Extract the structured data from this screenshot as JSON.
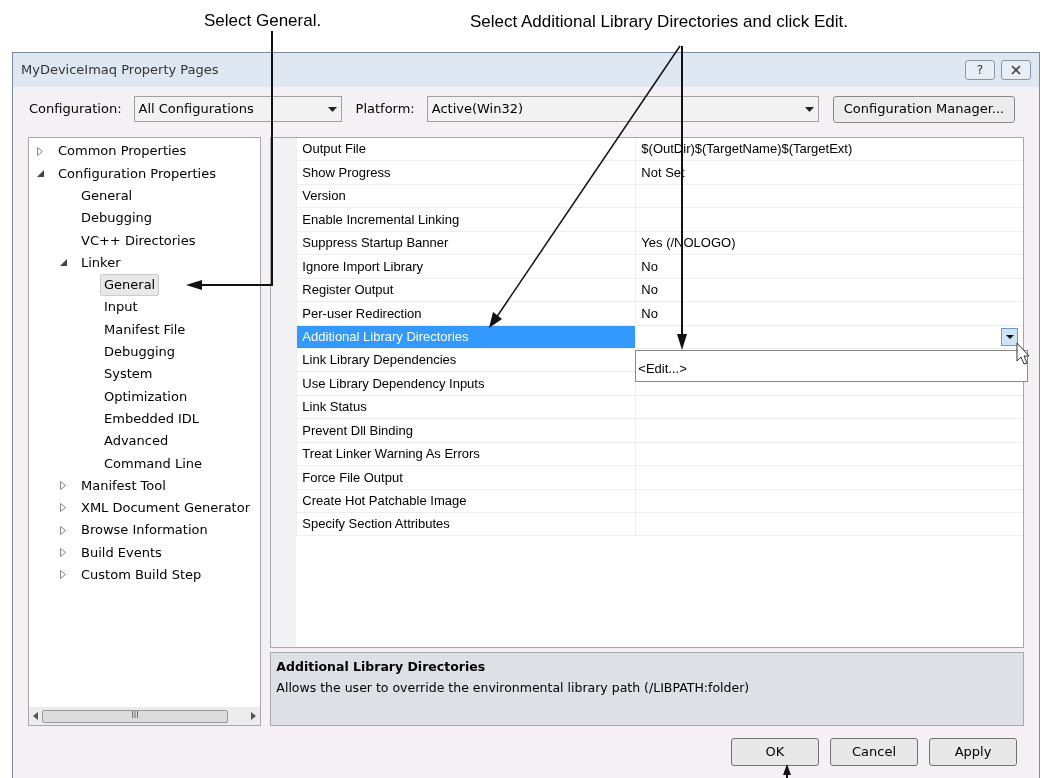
{
  "callouts": [
    "Select General.",
    "Select Additional Library Directories and click Edit."
  ],
  "window": {
    "title": "MyDeviceImaq Property Pages"
  },
  "configuration": {
    "label": "Configuration:",
    "value": "All Configurations"
  },
  "platform": {
    "label": "Platform:",
    "value": "Active(Win32)"
  },
  "configuration_manager_button": "Configuration Manager...",
  "tree": [
    {
      "label": "Common Properties",
      "expanded": false,
      "selected": false
    },
    {
      "label": "Configuration Properties",
      "expanded": true,
      "selected": false,
      "children": [
        {
          "label": "General",
          "selected": false
        },
        {
          "label": "Debugging",
          "selected": false
        },
        {
          "label": "VC++ Directories",
          "selected": false
        },
        {
          "label": "Linker",
          "expanded": true,
          "selected": false,
          "children": [
            {
              "label": "General",
              "selected": true
            },
            {
              "label": "Input",
              "selected": false
            },
            {
              "label": "Manifest File",
              "selected": false
            },
            {
              "label": "Debugging",
              "selected": false
            },
            {
              "label": "System",
              "selected": false
            },
            {
              "label": "Optimization",
              "selected": false
            },
            {
              "label": "Embedded IDL",
              "selected": false
            },
            {
              "label": "Advanced",
              "selected": false
            },
            {
              "label": "Command Line",
              "selected": false
            }
          ]
        },
        {
          "label": "Manifest Tool",
          "expanded": false,
          "selected": false
        },
        {
          "label": "XML Document Generator",
          "expanded": false,
          "selected": false
        },
        {
          "label": "Browse Information",
          "expanded": false,
          "selected": false
        },
        {
          "label": "Build Events",
          "expanded": false,
          "selected": false
        },
        {
          "label": "Custom Build Step",
          "expanded": false,
          "selected": false
        }
      ]
    }
  ],
  "properties": [
    {
      "name": "Output File",
      "value": "$(OutDir)$(TargetName)$(TargetExt)",
      "selected": false
    },
    {
      "name": "Show Progress",
      "value": "Not Set",
      "selected": false
    },
    {
      "name": "Version",
      "selected": false
    },
    {
      "name": "Enable Incremental Linking",
      "selected": false
    },
    {
      "name": "Suppress Startup Banner",
      "value": "Yes (/NOLOGO)",
      "selected": false
    },
    {
      "name": "Ignore Import Library",
      "value": "No",
      "selected": false
    },
    {
      "name": "Register Output",
      "value": "No",
      "selected": false
    },
    {
      "name": "Per-user Redirection",
      "value": "No",
      "selected": false
    },
    {
      "name": "Additional Library Directories",
      "selected": true
    },
    {
      "name": "Link Library Dependencies",
      "selected": false
    },
    {
      "name": "Use Library Dependency Inputs",
      "selected": false
    },
    {
      "name": "Link Status",
      "selected": false
    },
    {
      "name": "Prevent Dll Binding",
      "selected": false
    },
    {
      "name": "Treat Linker Warning As Errors",
      "selected": false
    },
    {
      "name": "Force File Output",
      "selected": false
    },
    {
      "name": "Create Hot Patchable Image",
      "selected": false
    },
    {
      "name": "Specify Section Attributes",
      "selected": false
    }
  ],
  "dropdown_options": [
    "<Edit...>"
  ],
  "description": {
    "title": "Additional Library Directories",
    "text": "Allows the user to override the environmental library path (/LIBPATH:folder)"
  },
  "scrollbar_grip": "III",
  "title_buttons": [
    "?"
  ],
  "buttons": [
    "OK",
    "Cancel",
    "Apply"
  ]
}
